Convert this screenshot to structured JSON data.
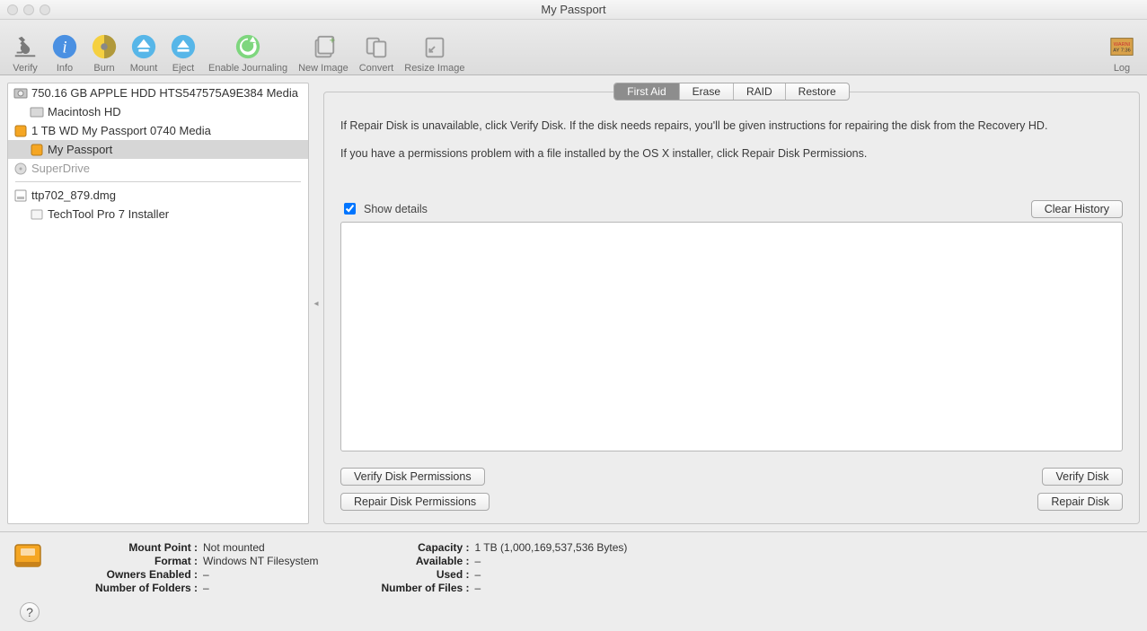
{
  "window": {
    "title": "My Passport"
  },
  "toolbar": {
    "verify": "Verify",
    "info": "Info",
    "burn": "Burn",
    "mount": "Mount",
    "eject": "Eject",
    "enable_journaling": "Enable Journaling",
    "new_image": "New Image",
    "convert": "Convert",
    "resize_image": "Resize Image",
    "log": "Log"
  },
  "sidebar": {
    "items": [
      {
        "label": "750.16 GB APPLE HDD HTS547575A9E384 Media",
        "icon": "internal-disk",
        "indent": 0
      },
      {
        "label": "Macintosh HD",
        "icon": "internal-disk",
        "indent": 1
      },
      {
        "label": "1 TB WD My Passport 0740 Media",
        "icon": "external-disk",
        "indent": 0
      },
      {
        "label": "My Passport",
        "icon": "external-disk",
        "indent": 1,
        "selected": true
      },
      {
        "label": "SuperDrive",
        "icon": "optical",
        "indent": 0,
        "dim": true
      }
    ],
    "items2": [
      {
        "label": "ttp702_879.dmg",
        "icon": "dmg",
        "indent": 0
      },
      {
        "label": "TechTool Pro 7 Installer",
        "icon": "volume",
        "indent": 1
      }
    ]
  },
  "tabs": {
    "first_aid": "First Aid",
    "erase": "Erase",
    "raid": "RAID",
    "restore": "Restore"
  },
  "panel": {
    "info1": "If Repair Disk is unavailable, click Verify Disk. If the disk needs repairs, you'll be given instructions for repairing the disk from the Recovery HD.",
    "info2": "If you have a permissions problem with a file installed by the OS X installer, click Repair Disk Permissions.",
    "show_details": "Show details",
    "clear_history": "Clear History",
    "verify_perms": "Verify Disk Permissions",
    "repair_perms": "Repair Disk Permissions",
    "verify_disk": "Verify Disk",
    "repair_disk": "Repair Disk"
  },
  "footer": {
    "left": {
      "mount_point_k": "Mount Point :",
      "mount_point_v": "Not mounted",
      "format_k": "Format :",
      "format_v": "Windows NT Filesystem",
      "owners_k": "Owners Enabled :",
      "owners_v": "–",
      "folders_k": "Number of Folders :",
      "folders_v": "–"
    },
    "right": {
      "capacity_k": "Capacity :",
      "capacity_v": "1 TB (1,000,169,537,536 Bytes)",
      "available_k": "Available :",
      "available_v": "–",
      "used_k": "Used :",
      "used_v": "–",
      "files_k": "Number of Files :",
      "files_v": "–"
    }
  }
}
